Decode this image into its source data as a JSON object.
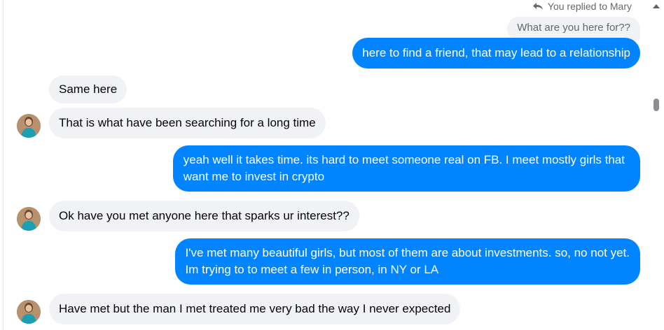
{
  "reply_header": {
    "text": "You replied to Mary",
    "icon": "reply-arrow-icon"
  },
  "quoted_message": "What are you here for??",
  "messages": [
    {
      "text": "here to find a friend, that may lead to a relationship",
      "direction": "outgoing"
    },
    {
      "text": "Same here",
      "direction": "incoming"
    },
    {
      "text": "That is what have been searching for a long time",
      "direction": "incoming"
    },
    {
      "text": "yeah well it takes time.  its hard to meet someone real on FB. I meet mostly girls that",
      "text2": "want me to invest in crypto",
      "direction": "outgoing"
    },
    {
      "text": "Ok have you met anyone here that sparks ur interest??",
      "direction": "incoming"
    },
    {
      "text": "I've met many beautiful girls, but most of them are about investments. so, no not yet.",
      "text2": "Im trying to to meet a few in person, in NY or LA",
      "direction": "outgoing"
    },
    {
      "text": "Have met but the man I met treated me very bad the way I never expected",
      "direction": "incoming"
    }
  ],
  "colors": {
    "outgoing": "#0084ff",
    "incoming": "#f0f2f5",
    "meta_text": "#65676b"
  }
}
